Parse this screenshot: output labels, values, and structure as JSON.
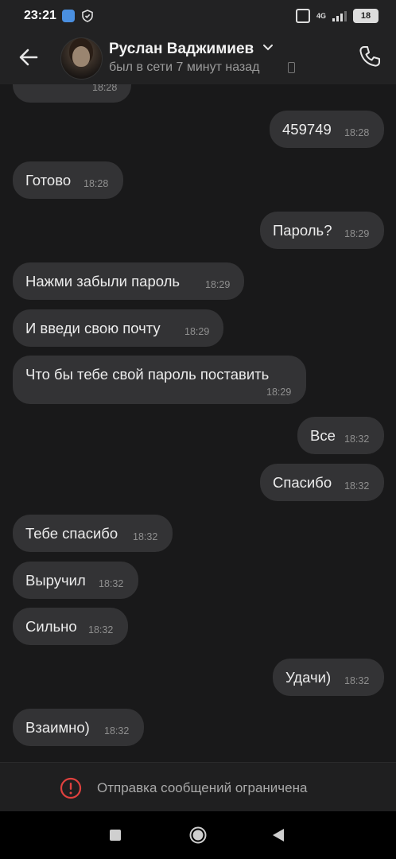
{
  "status_bar": {
    "time": "23:21",
    "network": "4G",
    "battery": "18"
  },
  "header": {
    "contact_name": "Руслан Ваджимиев",
    "last_seen": "был в сети 7 минут назад"
  },
  "messages": [
    {
      "side": "in",
      "text": "",
      "time": "18:28"
    },
    {
      "side": "out",
      "text": "459749",
      "time": "18:28"
    },
    {
      "side": "in",
      "text": "Готово",
      "time": "18:28"
    },
    {
      "side": "out",
      "text": "Пароль?",
      "time": "18:29"
    },
    {
      "side": "in",
      "text": "Нажми забыли пароль",
      "time": "18:29"
    },
    {
      "side": "in",
      "text": "И введи свою почту",
      "time": "18:29"
    },
    {
      "side": "in",
      "text": "Что бы тебе свой пароль поставить",
      "time": "18:29"
    },
    {
      "side": "out",
      "text": "Все",
      "time": "18:32"
    },
    {
      "side": "out",
      "text": "Спасибо",
      "time": "18:32"
    },
    {
      "side": "in",
      "text": "Тебе спасибо",
      "time": "18:32"
    },
    {
      "side": "in",
      "text": "Выручил",
      "time": "18:32"
    },
    {
      "side": "in",
      "text": "Сильно",
      "time": "18:32"
    },
    {
      "side": "out",
      "text": "Удачи)",
      "time": "18:32"
    },
    {
      "side": "in",
      "text": "Взаимно)",
      "time": "18:32"
    }
  ],
  "composer": {
    "restricted_text": "Отправка сообщений ограничена"
  },
  "colors": {
    "background": "#19191a",
    "bubble": "#333335",
    "warning": "#e0413e"
  }
}
